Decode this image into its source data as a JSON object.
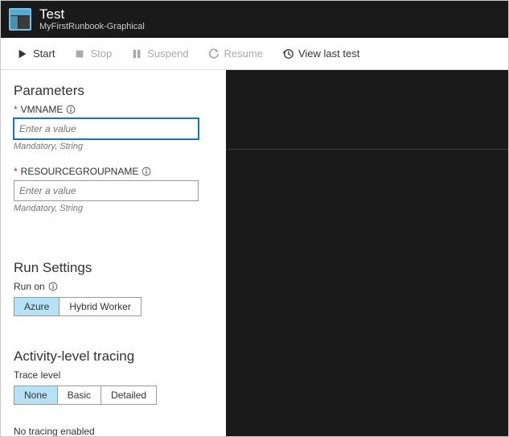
{
  "header": {
    "title": "Test",
    "subtitle": "MyFirstRunbook-Graphical"
  },
  "toolbar": {
    "start": "Start",
    "stop": "Stop",
    "suspend": "Suspend",
    "resume": "Resume",
    "viewLast": "View last test"
  },
  "parameters": {
    "heading": "Parameters",
    "vmname": {
      "label": "VMNAME",
      "placeholder": "Enter a value",
      "hint": "Mandatory, String"
    },
    "rgname": {
      "label": "RESOURCEGROUPNAME",
      "placeholder": "Enter a value",
      "hint": "Mandatory, String"
    }
  },
  "runSettings": {
    "heading": "Run Settings",
    "label": "Run on",
    "options": {
      "azure": "Azure",
      "hybrid": "Hybrid Worker"
    }
  },
  "tracing": {
    "heading": "Activity-level tracing",
    "label": "Trace level",
    "options": {
      "none": "None",
      "basic": "Basic",
      "detailed": "Detailed"
    },
    "message": "No tracing enabled"
  }
}
